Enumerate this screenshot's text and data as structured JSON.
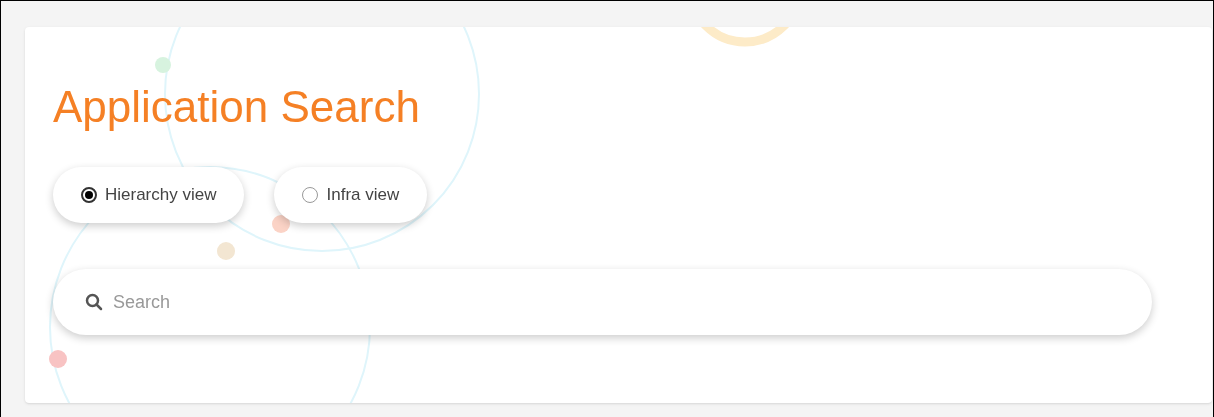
{
  "title": "Application Search",
  "view_options": [
    {
      "label": "Hierarchy view",
      "selected": true
    },
    {
      "label": "Infra view",
      "selected": false
    }
  ],
  "search": {
    "placeholder": "Search"
  }
}
